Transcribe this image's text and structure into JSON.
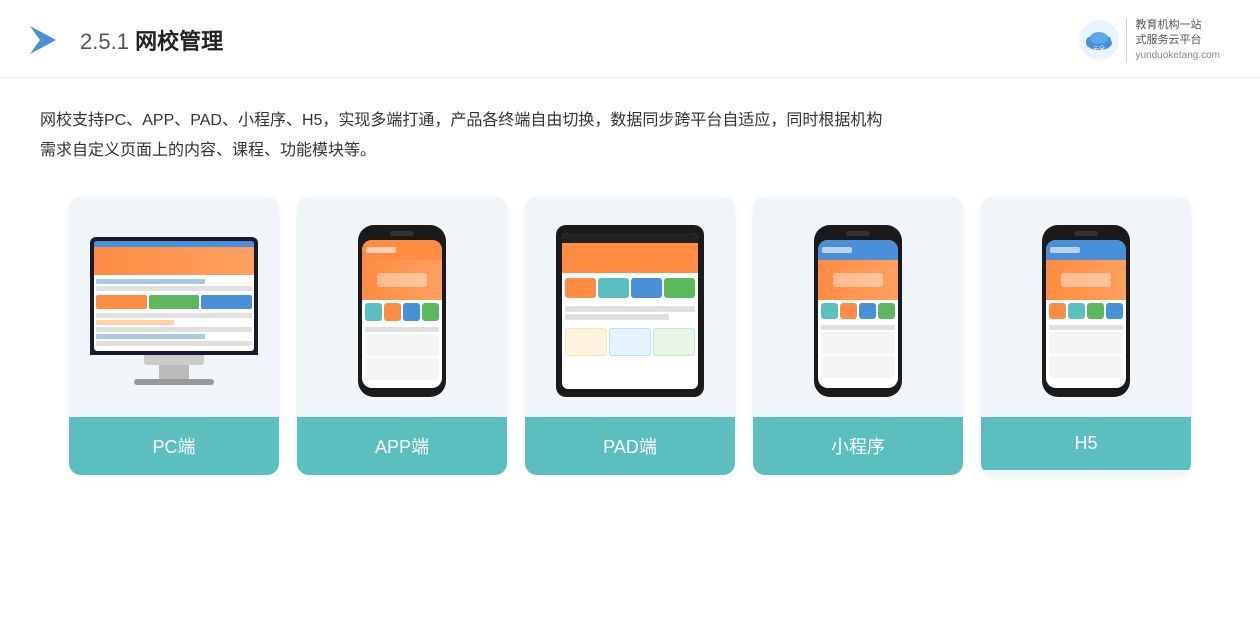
{
  "header": {
    "section_num": "2.5.1",
    "title": "网校管理",
    "brand_name": "云朵课堂",
    "brand_domain": "yunduoketang.com",
    "brand_tagline1": "教育机构一站",
    "brand_tagline2": "式服务云平台"
  },
  "description": {
    "line1": "网校支持PC、APP、PAD、小程序、H5，实现多端打通，产品各终端自由切换，数据同步跨平台自适应，同时根据机构",
    "line2": "需求自定义页面上的内容、课程、功能模块等。"
  },
  "cards": [
    {
      "id": "pc",
      "label": "PC端"
    },
    {
      "id": "app",
      "label": "APP端"
    },
    {
      "id": "pad",
      "label": "PAD端"
    },
    {
      "id": "miniprogram",
      "label": "小程序"
    },
    {
      "id": "h5",
      "label": "H5"
    }
  ],
  "colors": {
    "card_bg": "#eef4f9",
    "card_label_bg": "#5bbfbf",
    "accent_orange": "#ff8c42",
    "accent_blue": "#4a90d9"
  }
}
